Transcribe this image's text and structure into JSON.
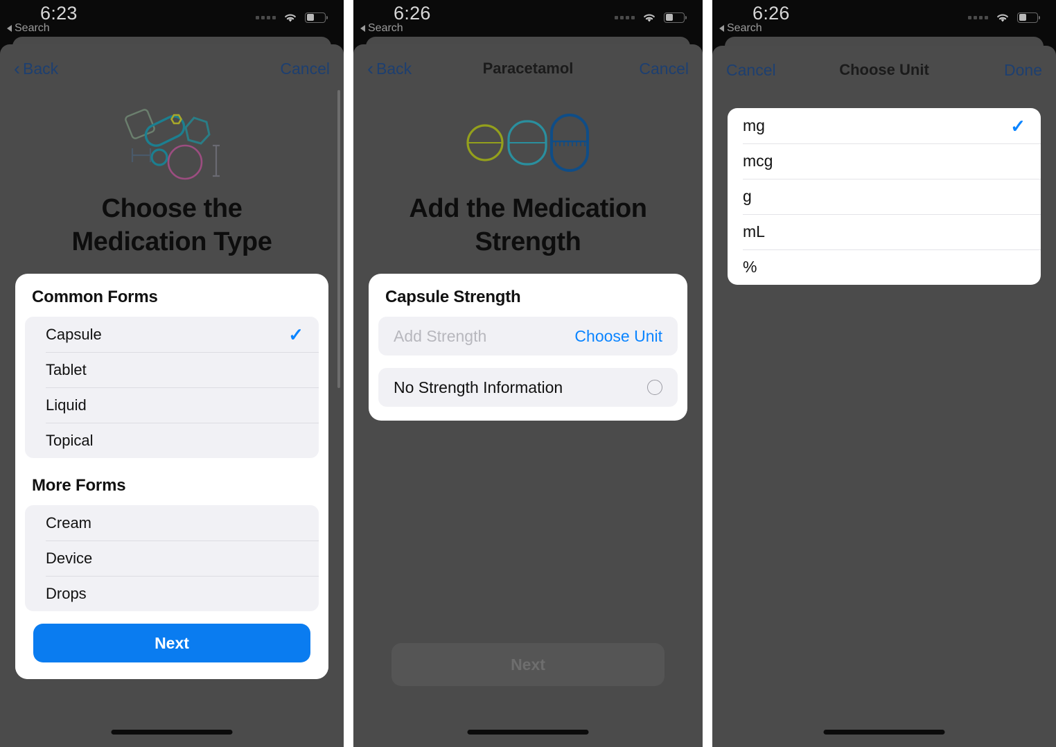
{
  "theme": {
    "accent_blue": "#0a7cf0",
    "link_blue": "#1d3f70",
    "check_blue": "#0a84ff",
    "sheet_bg": "#4b4b4b",
    "card_bg": "#ffffff",
    "row_bg": "#f1f1f5"
  },
  "panels": [
    {
      "status": {
        "time": "6:23",
        "back_label": "Search",
        "wifi_icon": "wifi-icon",
        "battery_icon": "battery-icon",
        "signal_icon": "signal-dots-icon"
      },
      "nav": {
        "back_label": "Back",
        "title": "",
        "right_label": "Cancel",
        "back_chevron_icon": "chevron-left-icon"
      },
      "hero": {
        "art_icon": "medication-shapes-illustration",
        "title": "Choose the\nMedication Type",
        "title_line1": "Choose the",
        "title_line2": "Medication Type"
      },
      "sections": [
        {
          "heading": "Common Forms",
          "items": [
            {
              "label": "Capsule",
              "selected": true,
              "check_icon": "checkmark-icon"
            },
            {
              "label": "Tablet",
              "selected": false
            },
            {
              "label": "Liquid",
              "selected": false
            },
            {
              "label": "Topical",
              "selected": false
            }
          ]
        },
        {
          "heading": "More Forms",
          "items": [
            {
              "label": "Cream",
              "selected": false
            },
            {
              "label": "Device",
              "selected": false
            },
            {
              "label": "Drops",
              "selected": false
            }
          ]
        }
      ],
      "primary_button": {
        "label": "Next",
        "enabled": true
      }
    },
    {
      "status": {
        "time": "6:26",
        "back_label": "Search",
        "wifi_icon": "wifi-icon",
        "battery_icon": "battery-icon",
        "signal_icon": "signal-dots-icon"
      },
      "nav": {
        "back_label": "Back",
        "title": "Paracetamol",
        "right_label": "Cancel",
        "back_chevron_icon": "chevron-left-icon"
      },
      "hero": {
        "art_icon": "capsule-shapes-illustration",
        "title_line1": "Add the Medication",
        "title_line2": "Strength"
      },
      "card": {
        "heading": "Capsule Strength",
        "strength_field": {
          "placeholder": "Add Strength",
          "value": "",
          "action_label": "Choose Unit"
        },
        "no_strength_option": {
          "label": "No Strength Information",
          "selected": false,
          "radio_icon": "radio-circle-icon"
        }
      },
      "primary_button": {
        "label": "Next",
        "enabled": false
      }
    },
    {
      "status": {
        "time": "6:26",
        "back_label": "Search",
        "wifi_icon": "wifi-icon",
        "battery_icon": "battery-icon",
        "signal_icon": "signal-dots-icon"
      },
      "nav": {
        "back_label": "Cancel",
        "title": "Choose Unit",
        "right_label": "Done"
      },
      "units": [
        {
          "label": "mg",
          "selected": true,
          "check_icon": "checkmark-icon"
        },
        {
          "label": "mcg",
          "selected": false
        },
        {
          "label": "g",
          "selected": false
        },
        {
          "label": "mL",
          "selected": false
        },
        {
          "label": "%",
          "selected": false
        }
      ]
    }
  ]
}
